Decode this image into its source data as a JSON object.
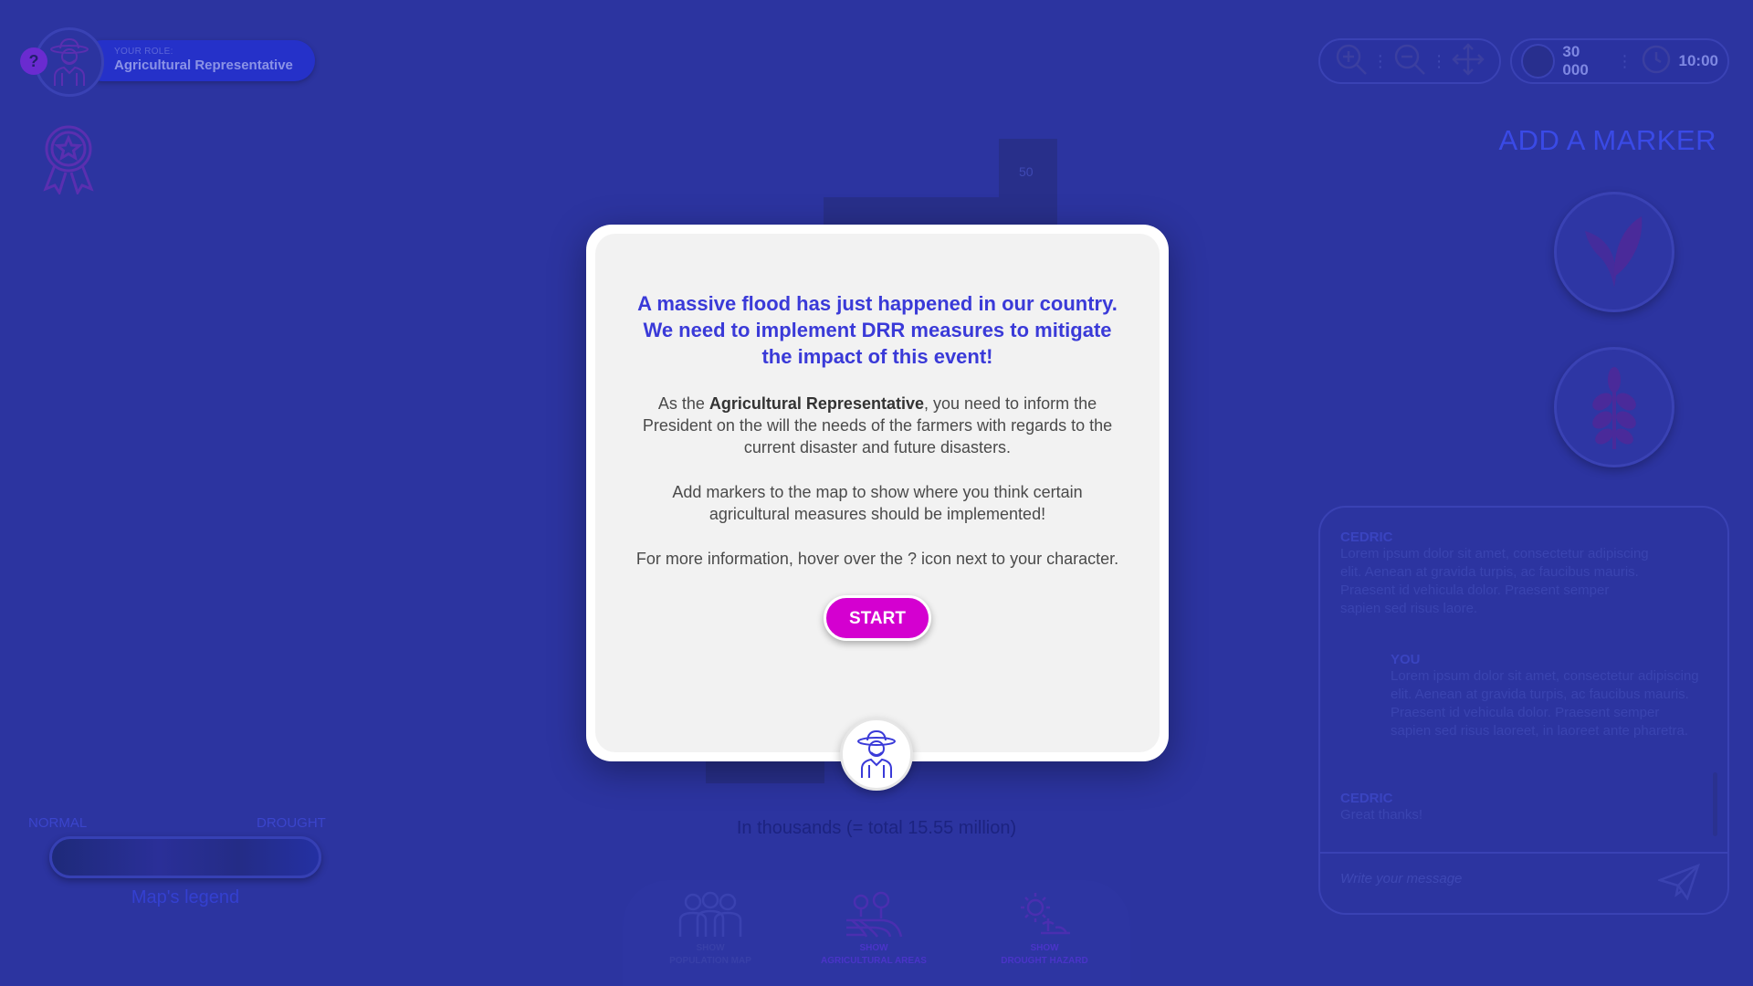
{
  "role": {
    "help_symbol": "?",
    "caption": "YOUR ROLE:",
    "name": "Agricultural Representative"
  },
  "icons": {
    "help": "question-mark-icon",
    "avatar": "farmer-icon",
    "award": "award-ribbon-icon",
    "zoom_in": "zoom-in-icon",
    "zoom_out": "zoom-out-icon",
    "pan": "move-arrows-icon",
    "coin": "coin-icon",
    "timer": "clock-icon",
    "marker1": "wheat-leaf-icon",
    "marker2": "grain-plant-icon",
    "send": "paper-plane-icon"
  },
  "status": {
    "budget": "30 000",
    "time": "10:00"
  },
  "markers": {
    "title": "ADD A MARKER"
  },
  "chart": {
    "top_label": "50",
    "caption": "In thousands (= total 15.55 million)"
  },
  "legend": {
    "left_label": "NORMAL",
    "right_label": "DROUGHT",
    "caption": "Map's legend"
  },
  "toolbar": {
    "population": {
      "line1": "SHOW",
      "line2": "POPULATION MAP"
    },
    "agricultural": {
      "line1": "SHOW",
      "line2": "AGRICULTURAL AREAS"
    },
    "drought": {
      "line1": "SHOW",
      "line2": "DROUGHT HAZARD"
    }
  },
  "chat": {
    "messages": [
      {
        "author": "CEDRIC",
        "text": "Lorem ipsum dolor sit amet, consectetur adipiscing elit. Aenean at gravida turpis, ac faucibus mauris. Praesent id vehicula dolor. Praesent semper sapien sed risus laore."
      },
      {
        "author": "YOU",
        "text": "Lorem ipsum dolor sit amet, consectetur adipiscing elit. Aenean at gravida turpis, ac faucibus mauris. Praesent id vehicula dolor. Praesent semper sapien sed risus laoreet, in laoreet ante pharetra."
      },
      {
        "author": "CEDRIC",
        "text": "Great thanks!"
      }
    ],
    "placeholder": "Write your message"
  },
  "modal": {
    "headline": "A massive flood has just happened in our country. We need to implement DRR measures to mitigate the impact of this event!",
    "p1_prefix": "As the ",
    "p1_role": "Agricultural Representative",
    "p1_suffix": ", you need to inform the President on the will the needs of the farmers with regards to the current disaster and future disasters.",
    "p2": "Add markers to the map to show where you think certain agricultural measures should be implemented!",
    "p3": "For more information, hover over the ? icon next to your character.",
    "start_label": "START"
  },
  "colors": {
    "overlay_bg": "#2c34a0",
    "headline": "#3a3ad8",
    "start_button": "#d400d0"
  }
}
